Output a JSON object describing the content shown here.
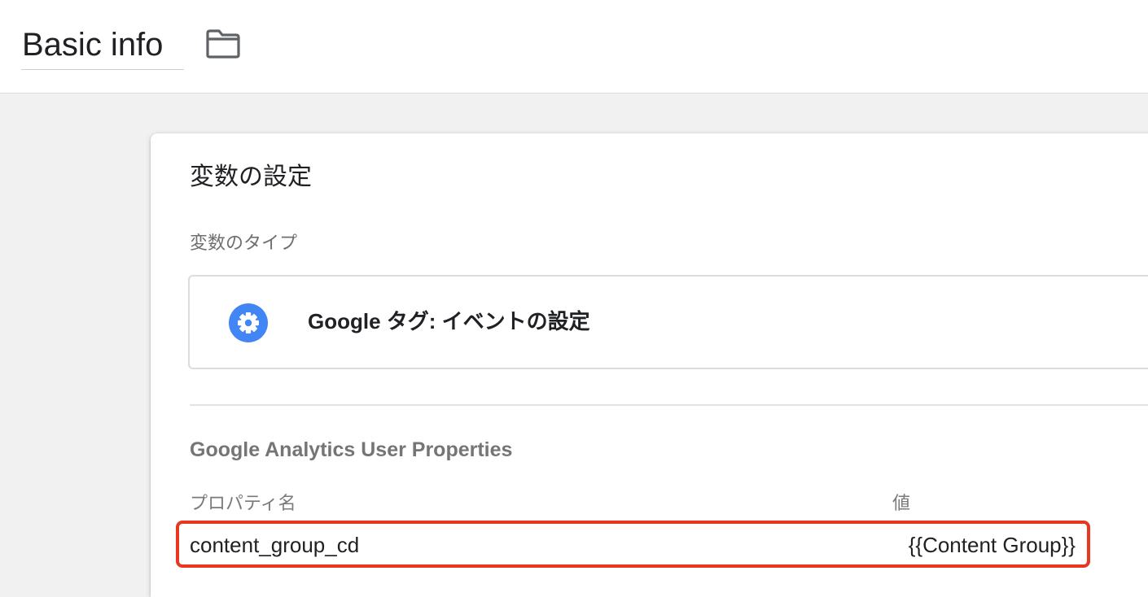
{
  "header": {
    "title": "Basic info",
    "folder_icon": "folder-icon"
  },
  "card": {
    "title": "変数の設定",
    "type_label": "変数のタイプ",
    "variable_type": {
      "icon": "gear-icon",
      "icon_color": "#4285f4",
      "name": "Google タグ: イベントの設定"
    },
    "section_title": "Google Analytics User Properties",
    "table": {
      "columns": [
        "プロパティ名",
        "値"
      ],
      "rows": [
        {
          "name": "content_group_cd",
          "value": "{{Content Group}}"
        }
      ]
    }
  },
  "colors": {
    "highlight": "#e8361f",
    "accent": "#4285f4",
    "background": "#f1f1f1"
  }
}
